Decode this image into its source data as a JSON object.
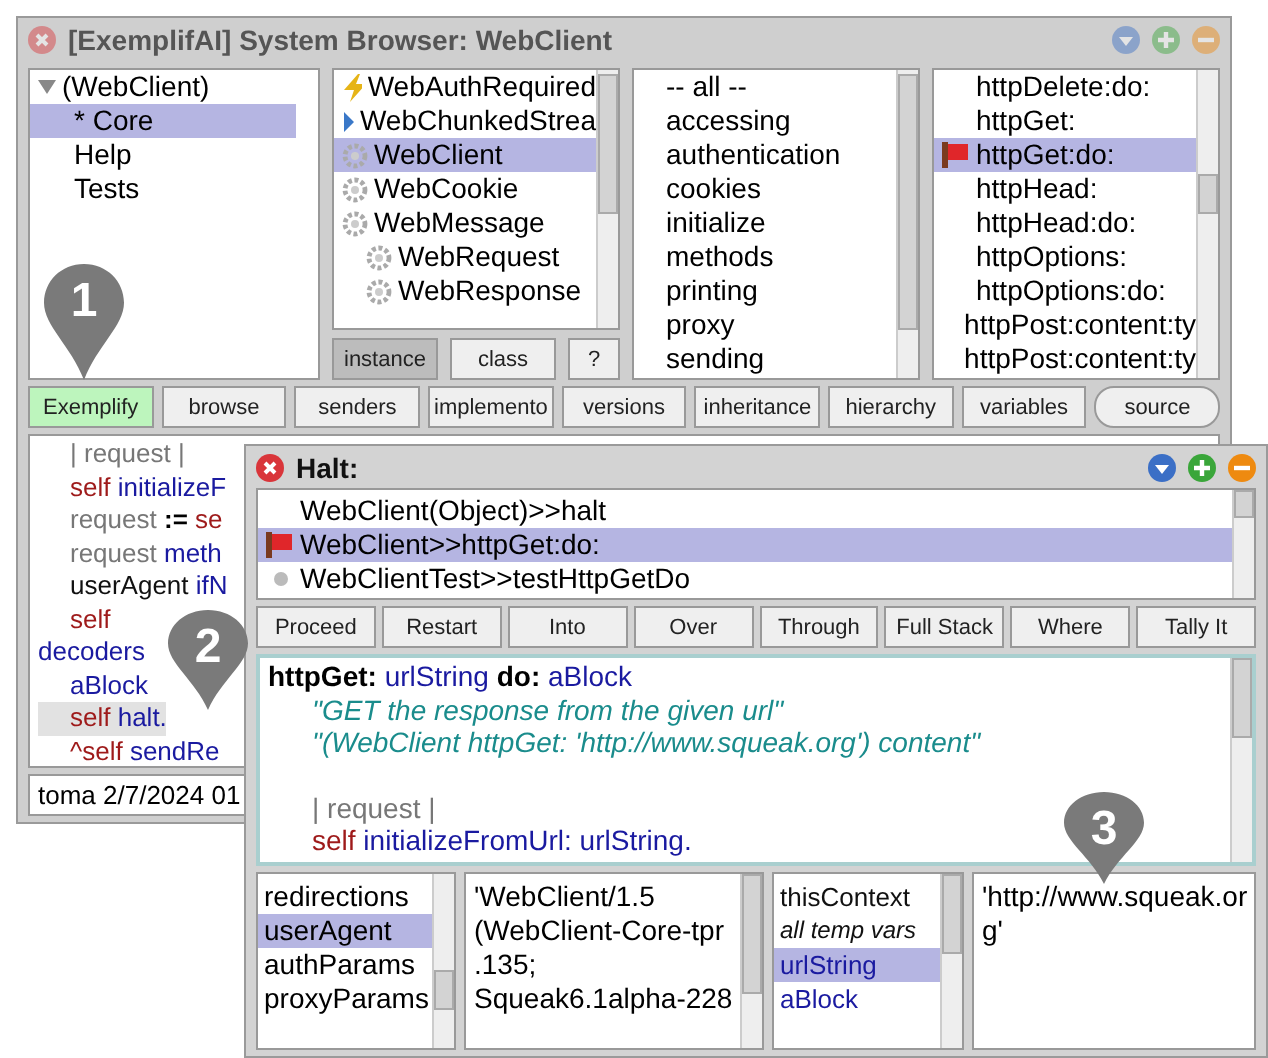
{
  "browser": {
    "title": "[ExemplifAI] System Browser: WebClient",
    "packages": [
      {
        "label": "(WebClient)",
        "expanded": true,
        "selected": false,
        "children": [
          {
            "label": "* Core",
            "selected": true
          },
          {
            "label": "Help",
            "selected": false
          },
          {
            "label": "Tests",
            "selected": false
          }
        ]
      }
    ],
    "classes": [
      {
        "label": "WebAuthRequired",
        "kind": "exception",
        "selected": false
      },
      {
        "label": "WebChunkedStrea",
        "kind": "stream",
        "selected": false
      },
      {
        "label": "WebClient",
        "kind": "class",
        "selected": true
      },
      {
        "label": "WebCookie",
        "kind": "class",
        "selected": false
      },
      {
        "label": "WebMessage",
        "kind": "class",
        "selected": false,
        "children": [
          {
            "label": "WebRequest",
            "kind": "class",
            "selected": false
          },
          {
            "label": "WebResponse",
            "kind": "class",
            "selected": false
          }
        ]
      }
    ],
    "class_toggle": [
      {
        "label": "instance",
        "selected": true
      },
      {
        "label": "class",
        "selected": false
      },
      {
        "label": "?",
        "selected": false
      }
    ],
    "categories": [
      {
        "label": "-- all --",
        "selected": false
      },
      {
        "label": "accessing",
        "selected": false
      },
      {
        "label": "authentication",
        "selected": false
      },
      {
        "label": "cookies",
        "selected": false
      },
      {
        "label": "initialize",
        "selected": false
      },
      {
        "label": "methods",
        "selected": false
      },
      {
        "label": "printing",
        "selected": false
      },
      {
        "label": "proxy",
        "selected": false
      },
      {
        "label": "sending",
        "selected": false
      }
    ],
    "methods": [
      {
        "label": "httpDelete:do:",
        "selected": false,
        "flag": false
      },
      {
        "label": "httpGet:",
        "selected": false,
        "flag": false
      },
      {
        "label": "httpGet:do:",
        "selected": true,
        "flag": true
      },
      {
        "label": "httpHead:",
        "selected": false,
        "flag": false
      },
      {
        "label": "httpHead:do:",
        "selected": false,
        "flag": false
      },
      {
        "label": "httpOptions:",
        "selected": false,
        "flag": false
      },
      {
        "label": "httpOptions:do:",
        "selected": false,
        "flag": false
      },
      {
        "label": "httpPost:content:ty",
        "selected": false,
        "flag": false
      },
      {
        "label": "httpPost:content:ty",
        "selected": false,
        "flag": false
      }
    ],
    "buttons": [
      {
        "label": "Exemplify",
        "selected": true
      },
      {
        "label": "browse",
        "selected": false
      },
      {
        "label": "senders",
        "selected": false
      },
      {
        "label": "implemento",
        "selected": false
      },
      {
        "label": "versions",
        "selected": false
      },
      {
        "label": "inheritance",
        "selected": false
      },
      {
        "label": "hierarchy",
        "selected": false
      },
      {
        "label": "variables",
        "selected": false
      },
      {
        "label": "source",
        "selected": false
      }
    ],
    "code": [
      {
        "indent": true,
        "highlighted": false,
        "tokens": [
          {
            "text": "| request |",
            "kind": "temp"
          }
        ]
      },
      {
        "indent": true,
        "highlighted": false,
        "tokens": [
          {
            "text": "self",
            "kind": "keyword"
          },
          {
            "text": " initializeF",
            "kind": "name"
          }
        ]
      },
      {
        "indent": true,
        "highlighted": false,
        "tokens": [
          {
            "text": "request",
            "kind": "temp"
          },
          {
            "text": " := ",
            "kind": "selector"
          },
          {
            "text": "se",
            "kind": "keyword"
          }
        ]
      },
      {
        "indent": true,
        "highlighted": false,
        "tokens": [
          {
            "text": "request",
            "kind": "temp"
          },
          {
            "text": " meth",
            "kind": "name"
          }
        ]
      },
      {
        "indent": true,
        "highlighted": false,
        "tokens": [
          {
            "text": "userAgent",
            "kind": "plain"
          },
          {
            "text": " ifN",
            "kind": "name"
          }
        ]
      },
      {
        "indent": true,
        "highlighted": false,
        "tokens": [
          {
            "text": "self",
            "kind": "keyword"
          }
        ]
      },
      {
        "indent": false,
        "highlighted": false,
        "tokens": [
          {
            "text": "decoders",
            "kind": "name"
          }
        ]
      },
      {
        "indent": true,
        "highlighted": false,
        "tokens": [
          {
            "text": "aBlock",
            "kind": "name"
          }
        ]
      },
      {
        "indent": true,
        "highlighted": true,
        "tokens": [
          {
            "text": "self",
            "kind": "keyword"
          },
          {
            "text": " halt.",
            "kind": "name"
          }
        ]
      },
      {
        "indent": true,
        "highlighted": false,
        "tokens": [
          {
            "text": "^self",
            "kind": "keyword"
          },
          {
            "text": " sendRe",
            "kind": "name"
          }
        ]
      }
    ],
    "status": "toma 2/7/2024 01"
  },
  "debugger": {
    "title": "Halt:",
    "stack": [
      {
        "label": "WebClient(Object)>>halt",
        "kind": "plain",
        "selected": false
      },
      {
        "label": "WebClient>>httpGet:do:",
        "kind": "breakpoint",
        "selected": true
      },
      {
        "label": "WebClientTest>>testHttpGetDo",
        "kind": "test",
        "selected": false
      }
    ],
    "buttons": [
      "Proceed",
      "Restart",
      "Into",
      "Over",
      "Through",
      "Full Stack",
      "Where",
      "Tally It"
    ],
    "code_blocks": [
      {
        "lines": [
          {
            "indent": false,
            "tokens": [
              {
                "text": "httpGet:",
                "kind": "selector"
              },
              {
                "text": " urlString",
                "kind": "name"
              },
              {
                "text": " do:",
                "kind": "selector"
              },
              {
                "text": " aBlock",
                "kind": "name"
              }
            ]
          },
          {
            "indent": true,
            "tokens": [
              {
                "text": "\"GET the response from the given url\"",
                "kind": "comment"
              }
            ]
          },
          {
            "indent": true,
            "tokens": [
              {
                "text": "\"(WebClient httpGet: 'http://www.squeak.org') content\"",
                "kind": "comment"
              }
            ]
          }
        ]
      },
      {
        "lines": [
          {
            "indent": true,
            "tokens": [
              {
                "text": "| request |",
                "kind": "temp"
              }
            ]
          },
          {
            "indent": true,
            "tokens": [
              {
                "text": "self",
                "kind": "keyword"
              },
              {
                "text": " initializeFromUrl: urlString.",
                "kind": "name"
              }
            ]
          }
        ]
      }
    ],
    "receiver_fields": [
      {
        "label": "redirections",
        "selected": false
      },
      {
        "label": "userAgent",
        "selected": true
      },
      {
        "label": "authParams",
        "selected": false
      },
      {
        "label": "proxyParams",
        "selected": false
      }
    ],
    "receiver_value": [
      "'WebClient/1.5",
      "(WebClient-Core-tpr",
      ".135;",
      "Squeak6.1alpha-228"
    ],
    "context_fields": [
      {
        "label": "thisContext",
        "kind": "special",
        "selected": false
      },
      {
        "label": "all temp vars",
        "kind": "temps",
        "selected": false
      },
      {
        "label": "urlString",
        "kind": "arg",
        "selected": true
      },
      {
        "label": "aBlock",
        "kind": "arg",
        "selected": false
      }
    ],
    "context_value": [
      "'http://www.squeak.or",
      "g'"
    ]
  },
  "markers": [
    "1",
    "2",
    "3"
  ]
}
